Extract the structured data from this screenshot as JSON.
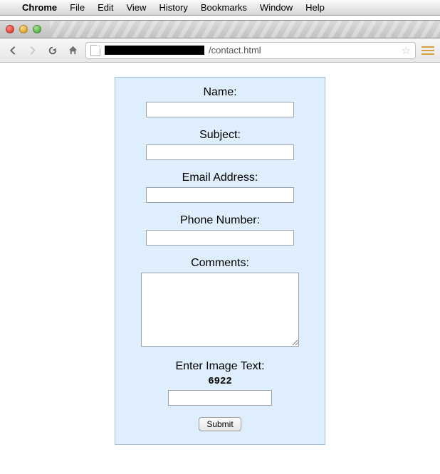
{
  "menubar": {
    "items": [
      "Chrome",
      "File",
      "Edit",
      "View",
      "History",
      "Bookmarks",
      "Window",
      "Help"
    ]
  },
  "url": {
    "visible_path": "/contact.html"
  },
  "form": {
    "name_label": "Name:",
    "subject_label": "Subject:",
    "email_label": "Email Address:",
    "phone_label": "Phone Number:",
    "comments_label": "Comments:",
    "captcha_label": "Enter Image Text:",
    "captcha_value": "6922",
    "submit_label": "Submit",
    "values": {
      "name": "",
      "subject": "",
      "email": "",
      "phone": "",
      "comments": "",
      "captcha": ""
    }
  }
}
